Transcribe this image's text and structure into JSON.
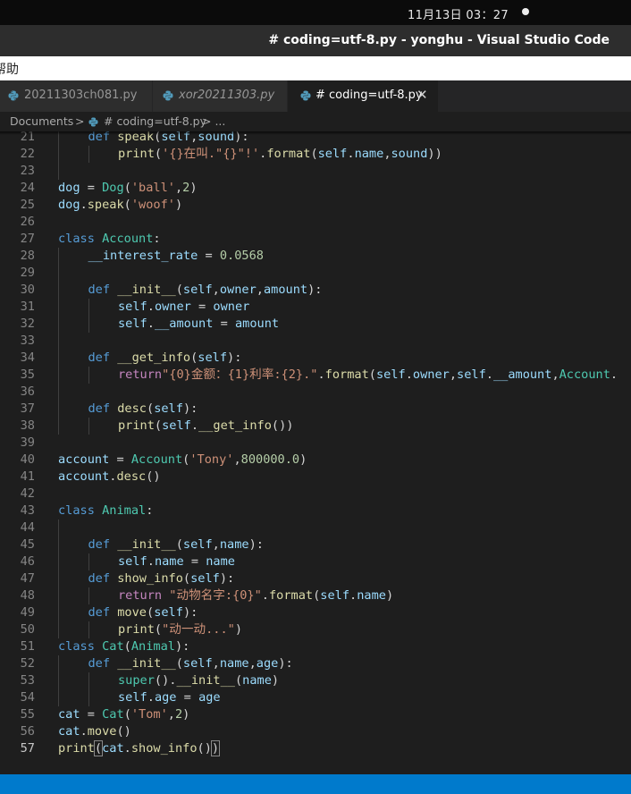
{
  "system_bar": {
    "clock": "11月13日 03：27"
  },
  "window": {
    "title": "# coding=utf-8.py - yonghu - Visual Studio Code"
  },
  "menubar": {
    "help": "帮助"
  },
  "tabs": [
    {
      "label": "20211303ch081.py",
      "icon": "python-icon"
    },
    {
      "label": "xor20211303.py",
      "icon": "python-icon"
    },
    {
      "label": "# coding=utf-8.py",
      "icon": "python-icon",
      "close": "✕"
    }
  ],
  "breadcrumb": {
    "folder": "Documents",
    "sep": ">",
    "file": "# coding=utf-8.py",
    "more": "> ..."
  },
  "colors": {
    "keyword": "#569cd6",
    "function": "#dcdcaa",
    "class": "#4ec9b0",
    "string": "#ce9178",
    "number": "#b5cea8",
    "variable": "#9cdcfe",
    "status_bar": "#007acc",
    "python_icon": "#519aba"
  },
  "editor": {
    "current_line": 57,
    "lines": [
      {
        "n": 21,
        "tokens": [
          [
            "kw",
            "def"
          ],
          [
            "p",
            " "
          ],
          [
            "fn",
            "speak"
          ],
          [
            "p",
            "("
          ],
          [
            "var",
            "self"
          ],
          [
            "p",
            ","
          ],
          [
            "var",
            "sound"
          ],
          [
            "p",
            "):"
          ]
        ]
      },
      {
        "n": 22,
        "tokens": [
          [
            "fn",
            "print"
          ],
          [
            "p",
            "("
          ],
          [
            "str",
            "'{}在叫.\"{}\"!'"
          ],
          [
            "p",
            "."
          ],
          [
            "fn",
            "format"
          ],
          [
            "p",
            "("
          ],
          [
            "var",
            "self"
          ],
          [
            "p",
            "."
          ],
          [
            "var",
            "name"
          ],
          [
            "p",
            ","
          ],
          [
            "var",
            "sound"
          ],
          [
            "p",
            "))"
          ]
        ]
      },
      {
        "n": 23,
        "tokens": []
      },
      {
        "n": 24,
        "tokens": [
          [
            "var",
            "dog"
          ],
          [
            "p",
            " = "
          ],
          [
            "cls",
            "Dog"
          ],
          [
            "p",
            "("
          ],
          [
            "str",
            "'ball'"
          ],
          [
            "p",
            ","
          ],
          [
            "num",
            "2"
          ],
          [
            "p",
            ")"
          ]
        ]
      },
      {
        "n": 25,
        "tokens": [
          [
            "var",
            "dog"
          ],
          [
            "p",
            "."
          ],
          [
            "fn",
            "speak"
          ],
          [
            "p",
            "("
          ],
          [
            "str",
            "'woof'"
          ],
          [
            "p",
            ")"
          ]
        ]
      },
      {
        "n": 26,
        "tokens": []
      },
      {
        "n": 27,
        "tokens": [
          [
            "kw",
            "class"
          ],
          [
            "p",
            " "
          ],
          [
            "cls",
            "Account"
          ],
          [
            "p",
            ":"
          ]
        ]
      },
      {
        "n": 28,
        "tokens": [
          [
            "var",
            "__interest_rate"
          ],
          [
            "p",
            " = "
          ],
          [
            "num",
            "0.0568"
          ]
        ]
      },
      {
        "n": 29,
        "tokens": []
      },
      {
        "n": 30,
        "tokens": [
          [
            "kw",
            "def"
          ],
          [
            "p",
            " "
          ],
          [
            "fn",
            "__init__"
          ],
          [
            "p",
            "("
          ],
          [
            "var",
            "self"
          ],
          [
            "p",
            ","
          ],
          [
            "var",
            "owner"
          ],
          [
            "p",
            ","
          ],
          [
            "var",
            "amount"
          ],
          [
            "p",
            "):"
          ]
        ]
      },
      {
        "n": 31,
        "tokens": [
          [
            "var",
            "self"
          ],
          [
            "p",
            "."
          ],
          [
            "var",
            "owner"
          ],
          [
            "p",
            " = "
          ],
          [
            "var",
            "owner"
          ]
        ]
      },
      {
        "n": 32,
        "tokens": [
          [
            "var",
            "self"
          ],
          [
            "p",
            "."
          ],
          [
            "var",
            "__amount"
          ],
          [
            "p",
            " = "
          ],
          [
            "var",
            "amount"
          ]
        ]
      },
      {
        "n": 33,
        "tokens": []
      },
      {
        "n": 34,
        "tokens": [
          [
            "kw",
            "def"
          ],
          [
            "p",
            " "
          ],
          [
            "fn",
            "__get_info"
          ],
          [
            "p",
            "("
          ],
          [
            "var",
            "self"
          ],
          [
            "p",
            "):"
          ]
        ]
      },
      {
        "n": 35,
        "tokens": [
          [
            "ctl",
            "return"
          ],
          [
            "str",
            "\"{0}金额：{1}利率:{2}.\""
          ],
          [
            "p",
            "."
          ],
          [
            "fn",
            "format"
          ],
          [
            "p",
            "("
          ],
          [
            "var",
            "self"
          ],
          [
            "p",
            "."
          ],
          [
            "var",
            "owner"
          ],
          [
            "p",
            ","
          ],
          [
            "var",
            "self"
          ],
          [
            "p",
            "."
          ],
          [
            "var",
            "__amount"
          ],
          [
            "p",
            ","
          ],
          [
            "cls",
            "Account"
          ],
          [
            "p",
            "."
          ]
        ]
      },
      {
        "n": 36,
        "tokens": []
      },
      {
        "n": 37,
        "tokens": [
          [
            "kw",
            "def"
          ],
          [
            "p",
            " "
          ],
          [
            "fn",
            "desc"
          ],
          [
            "p",
            "("
          ],
          [
            "var",
            "self"
          ],
          [
            "p",
            "):"
          ]
        ]
      },
      {
        "n": 38,
        "tokens": [
          [
            "fn",
            "print"
          ],
          [
            "p",
            "("
          ],
          [
            "var",
            "self"
          ],
          [
            "p",
            "."
          ],
          [
            "fn",
            "__get_info"
          ],
          [
            "p",
            "())"
          ]
        ]
      },
      {
        "n": 39,
        "tokens": []
      },
      {
        "n": 40,
        "tokens": [
          [
            "var",
            "account"
          ],
          [
            "p",
            " = "
          ],
          [
            "cls",
            "Account"
          ],
          [
            "p",
            "("
          ],
          [
            "str",
            "'Tony'"
          ],
          [
            "p",
            ","
          ],
          [
            "num",
            "800000.0"
          ],
          [
            "p",
            ")"
          ]
        ]
      },
      {
        "n": 41,
        "tokens": [
          [
            "var",
            "account"
          ],
          [
            "p",
            "."
          ],
          [
            "fn",
            "desc"
          ],
          [
            "p",
            "()"
          ]
        ]
      },
      {
        "n": 42,
        "tokens": []
      },
      {
        "n": 43,
        "tokens": [
          [
            "kw",
            "class"
          ],
          [
            "p",
            " "
          ],
          [
            "cls",
            "Animal"
          ],
          [
            "p",
            ":"
          ]
        ]
      },
      {
        "n": 44,
        "tokens": []
      },
      {
        "n": 45,
        "tokens": [
          [
            "kw",
            "def"
          ],
          [
            "p",
            " "
          ],
          [
            "fn",
            "__init__"
          ],
          [
            "p",
            "("
          ],
          [
            "var",
            "self"
          ],
          [
            "p",
            ","
          ],
          [
            "var",
            "name"
          ],
          [
            "p",
            "):"
          ]
        ]
      },
      {
        "n": 46,
        "tokens": [
          [
            "var",
            "self"
          ],
          [
            "p",
            "."
          ],
          [
            "var",
            "name"
          ],
          [
            "p",
            " = "
          ],
          [
            "var",
            "name"
          ]
        ]
      },
      {
        "n": 47,
        "tokens": [
          [
            "kw",
            "def"
          ],
          [
            "p",
            " "
          ],
          [
            "fn",
            "show_info"
          ],
          [
            "p",
            "("
          ],
          [
            "var",
            "self"
          ],
          [
            "p",
            "):"
          ]
        ]
      },
      {
        "n": 48,
        "tokens": [
          [
            "ctl",
            "return"
          ],
          [
            "p",
            " "
          ],
          [
            "str",
            "\"动物名字:{0}\""
          ],
          [
            "p",
            "."
          ],
          [
            "fn",
            "format"
          ],
          [
            "p",
            "("
          ],
          [
            "var",
            "self"
          ],
          [
            "p",
            "."
          ],
          [
            "var",
            "name"
          ],
          [
            "p",
            ")"
          ]
        ]
      },
      {
        "n": 49,
        "tokens": [
          [
            "kw",
            "def"
          ],
          [
            "p",
            " "
          ],
          [
            "fn",
            "move"
          ],
          [
            "p",
            "("
          ],
          [
            "var",
            "self"
          ],
          [
            "p",
            "):"
          ]
        ]
      },
      {
        "n": 50,
        "tokens": [
          [
            "fn",
            "print"
          ],
          [
            "p",
            "("
          ],
          [
            "str",
            "\"动一动...\""
          ],
          [
            "p",
            ")"
          ]
        ]
      },
      {
        "n": 51,
        "tokens": [
          [
            "kw",
            "class"
          ],
          [
            "p",
            " "
          ],
          [
            "cls",
            "Cat"
          ],
          [
            "p",
            "("
          ],
          [
            "cls",
            "Animal"
          ],
          [
            "p",
            "):"
          ]
        ]
      },
      {
        "n": 52,
        "tokens": [
          [
            "kw",
            "def"
          ],
          [
            "p",
            " "
          ],
          [
            "fn",
            "__init__"
          ],
          [
            "p",
            "("
          ],
          [
            "var",
            "self"
          ],
          [
            "p",
            ","
          ],
          [
            "var",
            "name"
          ],
          [
            "p",
            ","
          ],
          [
            "var",
            "age"
          ],
          [
            "p",
            "):"
          ]
        ]
      },
      {
        "n": 53,
        "tokens": [
          [
            "cls",
            "super"
          ],
          [
            "p",
            "()."
          ],
          [
            "fn",
            "__init__"
          ],
          [
            "p",
            "("
          ],
          [
            "var",
            "name"
          ],
          [
            "p",
            ")"
          ]
        ]
      },
      {
        "n": 54,
        "tokens": [
          [
            "var",
            "self"
          ],
          [
            "p",
            "."
          ],
          [
            "var",
            "age"
          ],
          [
            "p",
            " = "
          ],
          [
            "var",
            "age"
          ]
        ]
      },
      {
        "n": 55,
        "tokens": [
          [
            "var",
            "cat"
          ],
          [
            "p",
            " = "
          ],
          [
            "cls",
            "Cat"
          ],
          [
            "p",
            "("
          ],
          [
            "str",
            "'Tom'"
          ],
          [
            "p",
            ","
          ],
          [
            "num",
            "2"
          ],
          [
            "p",
            ")"
          ]
        ]
      },
      {
        "n": 56,
        "tokens": [
          [
            "var",
            "cat"
          ],
          [
            "p",
            "."
          ],
          [
            "fn",
            "move"
          ],
          [
            "p",
            "()"
          ]
        ]
      },
      {
        "n": 57,
        "tokens": [
          [
            "fn",
            "print"
          ],
          [
            "br",
            "("
          ],
          [
            "var",
            "cat"
          ],
          [
            "p",
            "."
          ],
          [
            "fn",
            "show_info"
          ],
          [
            "p",
            "()"
          ],
          [
            "br",
            ")"
          ]
        ]
      }
    ]
  }
}
